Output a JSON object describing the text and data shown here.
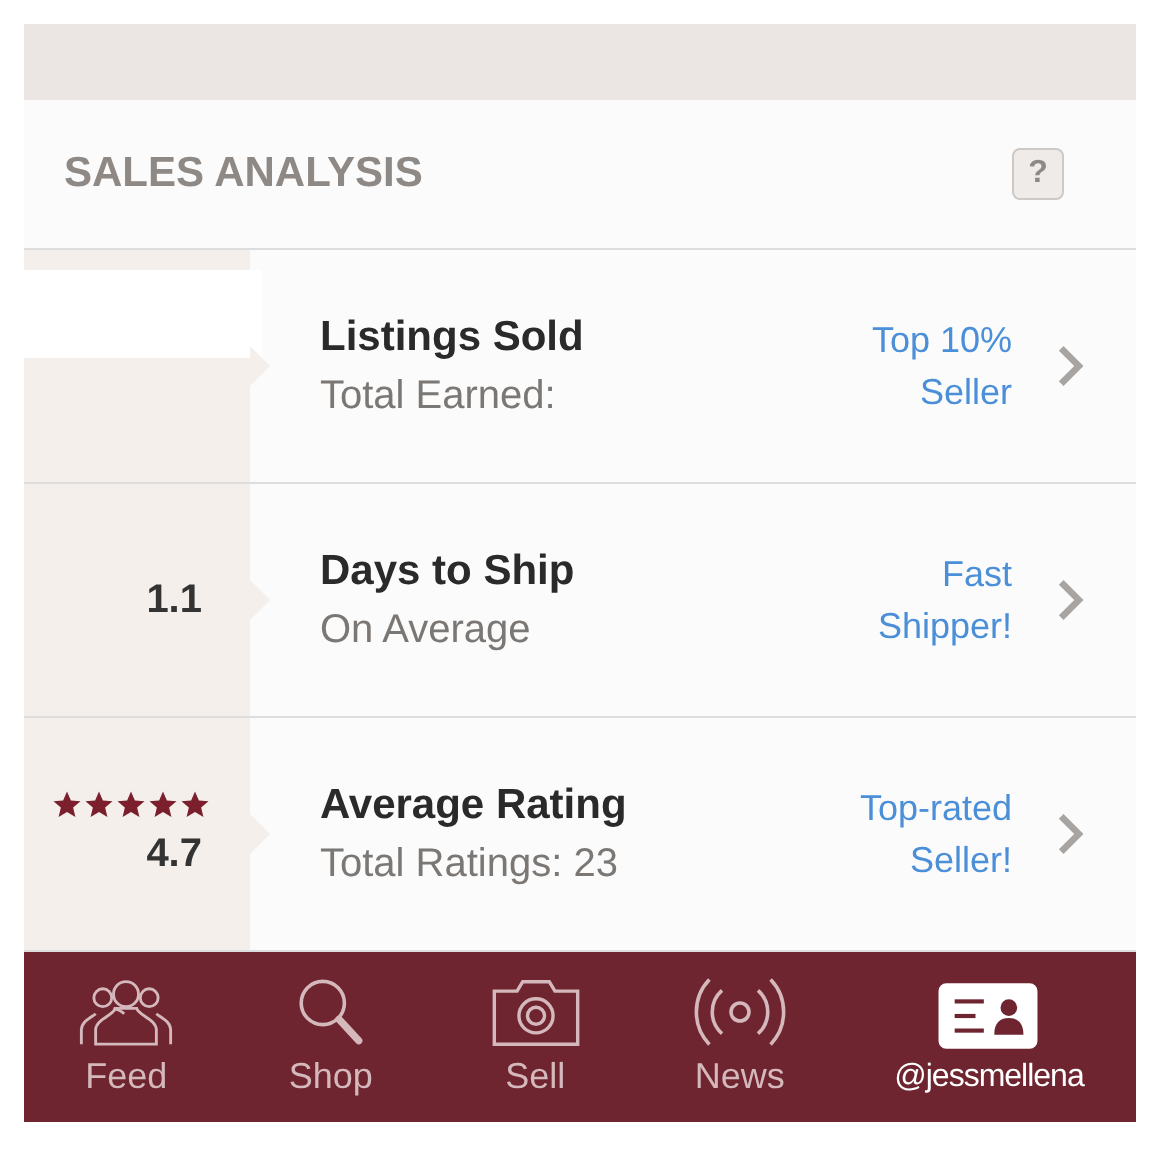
{
  "header": {
    "title": "SALES ANALYSIS",
    "help": "?"
  },
  "rows": [
    {
      "kind": "hidden",
      "title": "Listings Sold",
      "subtitle": "Total Earned:",
      "badge": [
        "Top 10%",
        "Seller"
      ]
    },
    {
      "kind": "value",
      "value": "1.1",
      "title": "Days to Ship",
      "subtitle": "On Average",
      "badge": [
        "Fast",
        "Shipper!"
      ]
    },
    {
      "kind": "rating",
      "stars": 5,
      "value": "4.7",
      "title": "Average Rating",
      "subtitle": "Total Ratings: 23",
      "badge": [
        "Top-rated",
        "Seller!"
      ]
    }
  ],
  "tabs": [
    {
      "kind": "people",
      "label": "Feed",
      "selected": false
    },
    {
      "kind": "search",
      "label": "Shop",
      "selected": false
    },
    {
      "kind": "camera",
      "label": "Sell",
      "selected": false
    },
    {
      "kind": "broadcast",
      "label": "News",
      "selected": false
    },
    {
      "kind": "card",
      "label": "@jessmellena",
      "selected": true
    }
  ]
}
